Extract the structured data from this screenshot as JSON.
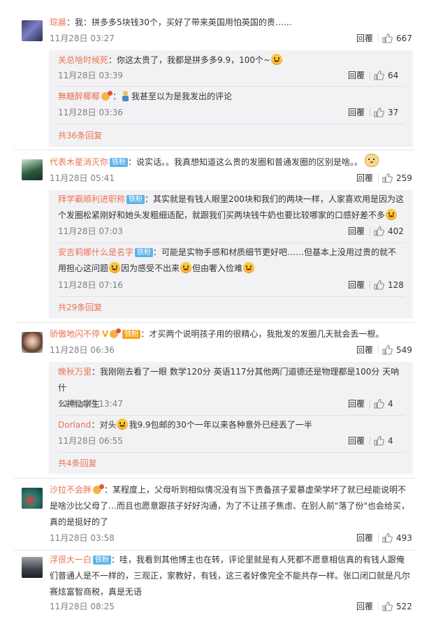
{
  "comments": [
    {
      "user": "琮晨",
      "sep": "：",
      "text": "我：拼多多5块钱30个，买好了带来英国用怕英国的贵……",
      "time": "11月28日 03:27",
      "reply": "回覆",
      "likes": "667",
      "replies": [
        {
          "user": "关总啥时候死",
          "sep": "：",
          "text": "你这太贵了，我都是拼多多9.9，100个~",
          "time": "11月28日 03:39",
          "reply": "回覆",
          "likes": "64"
        },
        {
          "user": "無糖醉椰椰",
          "sep": "：",
          "text": "我甚至以为是我发出的评论",
          "time": "11月28日 03:36",
          "reply": "回覆",
          "likes": "37"
        }
      ],
      "more": "共36条回复"
    },
    {
      "user": "代表木星消灭你",
      "badge": "铁粉",
      "sep": "：",
      "text": "说实话。。我真想知道这么贵的发圈和普通发圈的区别是啥。。",
      "time": "11月28日 05:41",
      "reply": "回覆",
      "likes": "259",
      "replies": [
        {
          "user": "拜学霸顺利进职称",
          "badge": "铁粉",
          "sep": "：",
          "text_l1": "其实就是有钱人眼里200块和我们的两块一样，人家喜欢用是因为这",
          "text_l2": "个发圈松紧刚好和她头发粗细适配，就跟我们买两块钱牛奶也要比较哪家的口感好差不多",
          "time": "11月28日 07:03",
          "reply": "回覆",
          "likes": "402"
        },
        {
          "user": "安吉莉娜什么是名字",
          "badge": "铁粉",
          "sep": "：",
          "text_l1": "可能是实物手感和材质细节更好吧……但基本上没用过贵的就不",
          "text_l2a": "用担心这问题",
          "text_l2b": "因为感受不出来",
          "text_l2c": "但由奢入俭难",
          "time": "11月28日 07:16",
          "reply": "回覆",
          "likes": "128"
        }
      ],
      "more": "共29条回复"
    },
    {
      "user": "骄傲地闪不停",
      "vmark": "V",
      "badge": "铁粉",
      "sep": "：",
      "text": "才买两个说明孩子用的很精心，我批发的发圈几天就会丢一根。",
      "time": "11月28日 06:36",
      "reply": "回覆",
      "likes": "549",
      "replies": [
        {
          "user": "晚秋万里",
          "sep": "：",
          "text_l1": "我刚刚去看了一眼 数学120分 英语117分其他两门道德还是物理都是100分 天呐什",
          "text_l2": "么神仙学生",
          "time": "11月28日 13:47",
          "reply": "回覆",
          "likes": "4"
        },
        {
          "user": "Dorland",
          "sep": "：",
          "text_a": "对头",
          "text_b": "我9.9包邮的30个一年以来各种意外已经丢了一半",
          "time": "11月28日 06:55",
          "reply": "回覆",
          "likes": "4"
        }
      ],
      "more": "共4条回复"
    },
    {
      "user": "沙拉不会胖",
      "sep": "：",
      "text_l1": "某程度上，父母听到相似情况没有当下责备孩子爱慕虚荣学坏了就已经能说明不",
      "text_l2": "是啥沙比父母了…而且也愿意跟孩子好好沟通，为了不让孩子焦虑、在别人前\"落了份\"也会给买，",
      "text_l3": "真的是挺好的了",
      "time": "11月28日 03:58",
      "reply": "回覆",
      "likes": "493"
    },
    {
      "user": "浮很大一白",
      "badge": "铁粉",
      "sep": "：",
      "text_l1": "哇，我看到其他博主也在转，评论里就是有人死都不愿意相信真的有钱人跟俺",
      "text_l2": "们普通人是不一样的，三观正，家教好，有钱，这三者好像完全不能共存一样。张口闭口就是凡尔",
      "text_l3": "赛炫富智商税，真是无语",
      "time": "11月28日 08:25",
      "reply": "回覆",
      "likes": "522"
    }
  ],
  "colors": {
    "username": "#eb7350",
    "reply_bg": "#f2f2f5",
    "badge": "#5fb4ea"
  },
  "icons": {
    "like": "thumbs-up-icon"
  }
}
